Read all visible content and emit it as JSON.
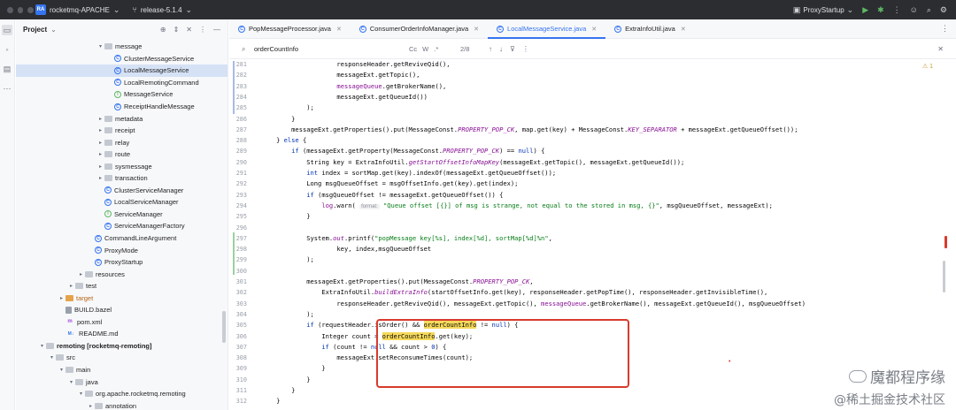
{
  "titlebar": {
    "project_badge": "RA",
    "project_name": "rocketmq-APACHE",
    "branch": "release-5.1.4",
    "run_config": "ProxyStartup"
  },
  "project_panel": {
    "title": "Project",
    "tree": [
      {
        "label": "message",
        "kind": "folder",
        "indent": 9,
        "arrow": "▾"
      },
      {
        "label": "ClusterMessageService",
        "kind": "class",
        "indent": 10
      },
      {
        "label": "LocalMessageService",
        "kind": "class",
        "indent": 10,
        "selected": true
      },
      {
        "label": "LocalRemotingCommand",
        "kind": "class",
        "indent": 10
      },
      {
        "label": "MessageService",
        "kind": "interface",
        "indent": 10
      },
      {
        "label": "ReceiptHandleMessage",
        "kind": "class",
        "indent": 10
      },
      {
        "label": "metadata",
        "kind": "folder",
        "indent": 9,
        "arrow": "▸"
      },
      {
        "label": "receipt",
        "kind": "folder",
        "indent": 9,
        "arrow": "▸"
      },
      {
        "label": "relay",
        "kind": "folder",
        "indent": 9,
        "arrow": "▸"
      },
      {
        "label": "route",
        "kind": "folder",
        "indent": 9,
        "arrow": "▸"
      },
      {
        "label": "sysmessage",
        "kind": "folder",
        "indent": 9,
        "arrow": "▸"
      },
      {
        "label": "transaction",
        "kind": "folder",
        "indent": 9,
        "arrow": "▸"
      },
      {
        "label": "ClusterServiceManager",
        "kind": "class",
        "indent": 9
      },
      {
        "label": "LocalServiceManager",
        "kind": "class",
        "indent": 9
      },
      {
        "label": "ServiceManager",
        "kind": "interface",
        "indent": 9
      },
      {
        "label": "ServiceManagerFactory",
        "kind": "class",
        "indent": 9
      },
      {
        "label": "CommandLineArgument",
        "kind": "class",
        "indent": 8
      },
      {
        "label": "ProxyMode",
        "kind": "class",
        "indent": 8
      },
      {
        "label": "ProxyStartup",
        "kind": "class",
        "indent": 8
      },
      {
        "label": "resources",
        "kind": "folder",
        "indent": 7,
        "arrow": "▸"
      },
      {
        "label": "test",
        "kind": "folder",
        "indent": 6,
        "arrow": "▸"
      },
      {
        "label": "target",
        "kind": "folder-orange",
        "indent": 5,
        "arrow": "▸",
        "orange": true
      },
      {
        "label": "BUILD.bazel",
        "kind": "file",
        "indent": 5
      },
      {
        "label": "pom.xml",
        "kind": "xml",
        "indent": 5
      },
      {
        "label": "README.md",
        "kind": "md",
        "indent": 5
      },
      {
        "label": "remoting [rocketmq-remoting]",
        "kind": "folder",
        "indent": 3,
        "arrow": "▾",
        "bold": true
      },
      {
        "label": "src",
        "kind": "folder",
        "indent": 4,
        "arrow": "▾"
      },
      {
        "label": "main",
        "kind": "folder",
        "indent": 5,
        "arrow": "▾"
      },
      {
        "label": "java",
        "kind": "folder",
        "indent": 6,
        "arrow": "▾"
      },
      {
        "label": "org.apache.rocketmq.remoting",
        "kind": "folder",
        "indent": 7,
        "arrow": "▾"
      },
      {
        "label": "annotation",
        "kind": "folder",
        "indent": 8,
        "arrow": "▸"
      }
    ]
  },
  "tabs": [
    {
      "label": "PopMessageProcessor.java",
      "active": false
    },
    {
      "label": "ConsumerOrderInfoManager.java",
      "active": false
    },
    {
      "label": "LocalMessageService.java",
      "active": true
    },
    {
      "label": "ExtraInfoUtil.java",
      "active": false
    }
  ],
  "find": {
    "query": "orderCountInfo",
    "options": [
      "Cc",
      "W",
      ".*"
    ],
    "count": "2/8"
  },
  "editor": {
    "warning_count": "1",
    "lines": [
      {
        "n": "281",
        "html": "                    responseHeader.getReviveQid(),"
      },
      {
        "n": "282",
        "html": "                    messageExt.getTopic(),"
      },
      {
        "n": "283",
        "html": "                    <span class=\"v\">messageQueue</span>.getBrokerName(),"
      },
      {
        "n": "284",
        "html": "                    messageExt.getQueueId())"
      },
      {
        "n": "285",
        "html": "            );"
      },
      {
        "n": "286",
        "html": "        }"
      },
      {
        "n": "287",
        "html": "        messageExt.getProperties().put(MessageConst.<span class=\"f\">PROPERTY_POP_CK</span>, map.get(key) + MessageConst.<span class=\"f\">KEY_SEPARATOR</span> + messageExt.getQueueOffset());"
      },
      {
        "n": "288",
        "html": "    } <span class=\"k\">else</span> {"
      },
      {
        "n": "289",
        "html": "        <span class=\"k\">if</span> (messageExt.getProperty(MessageConst.<span class=\"f\">PROPERTY_POP_CK</span>) == <span class=\"k\">null</span>) {"
      },
      {
        "n": "290",
        "html": "            String key = ExtraInfoUtil.<span class=\"f\">getStartOffsetInfoMapKey</span>(messageExt.getTopic(), messageExt.getQueueId());"
      },
      {
        "n": "291",
        "html": "            <span class=\"k\">int</span> index = sortMap.get(key).indexOf(messageExt.getQueueOffset());"
      },
      {
        "n": "292",
        "html": "            Long msgQueueOffset = msgOffsetInfo.get(key).get(index);"
      },
      {
        "n": "293",
        "html": "            <span class=\"k\">if</span> (msgQueueOffset != messageExt.getQueueOffset()) {"
      },
      {
        "n": "294",
        "html": "                <span class=\"v\">log</span>.warn( <span class=\"hint\">format:</span> <span class=\"s\">\"Queue offset [{}] of msg is strange, not equal to the stored in msg, {}\"</span>, msgQueueOffset, messageExt);"
      },
      {
        "n": "295",
        "html": "            }"
      },
      {
        "n": "296",
        "html": ""
      },
      {
        "n": "297",
        "html": "            System.<span class=\"f\">out</span>.printf(<span class=\"s\">\"popMessage key[%s], index[%d], sortMap[%d]%n\"</span>,"
      },
      {
        "n": "298",
        "html": "                    key, index,msgQueueOffset"
      },
      {
        "n": "299",
        "html": "            );"
      },
      {
        "n": "300",
        "html": ""
      },
      {
        "n": "301",
        "html": "            messageExt.getProperties().put(MessageConst.<span class=\"f\">PROPERTY_POP_CK</span>,"
      },
      {
        "n": "302",
        "html": "                ExtraInfoUtil.<span class=\"f\">buildExtraInfo</span>(startOffsetInfo.get(key), responseHeader.getPopTime(), responseHeader.getInvisibleTime(),"
      },
      {
        "n": "303",
        "html": "                    responseHeader.getReviveQid(), messageExt.getTopic(), <span class=\"v\">messageQueue</span>.getBrokerName(), messageExt.getQueueId(), msgQueueOffset)"
      },
      {
        "n": "304",
        "html": "            );"
      },
      {
        "n": "305",
        "html": "            <span class=\"k\">if</span> (requestHeader.isOrder() &amp;&amp; <span class=\"hl\">orderCountInfo</span> != <span class=\"k\">null</span>) {"
      },
      {
        "n": "306",
        "html": "                Integer count = <span class=\"hl\">orderCountInfo</span>.get(key);"
      },
      {
        "n": "307",
        "html": "                <span class=\"k\">if</span> (count != <span class=\"k\">null</span> &amp;&amp; count &gt; <span class=\"k\">0</span>) {"
      },
      {
        "n": "308",
        "html": "                    messageExt.setReconsumeTimes(count);"
      },
      {
        "n": "309",
        "html": "                }"
      },
      {
        "n": "310",
        "html": "            }"
      },
      {
        "n": "311",
        "html": "        }"
      },
      {
        "n": "312",
        "html": "    }"
      }
    ]
  },
  "watermark": {
    "line1": "魔都程序缘",
    "line2": "@稀土掘金技术社区"
  },
  "colors": {
    "accent": "#3574f0",
    "highlight_box": "#d83b2c",
    "search_match": "#f5d95a"
  }
}
